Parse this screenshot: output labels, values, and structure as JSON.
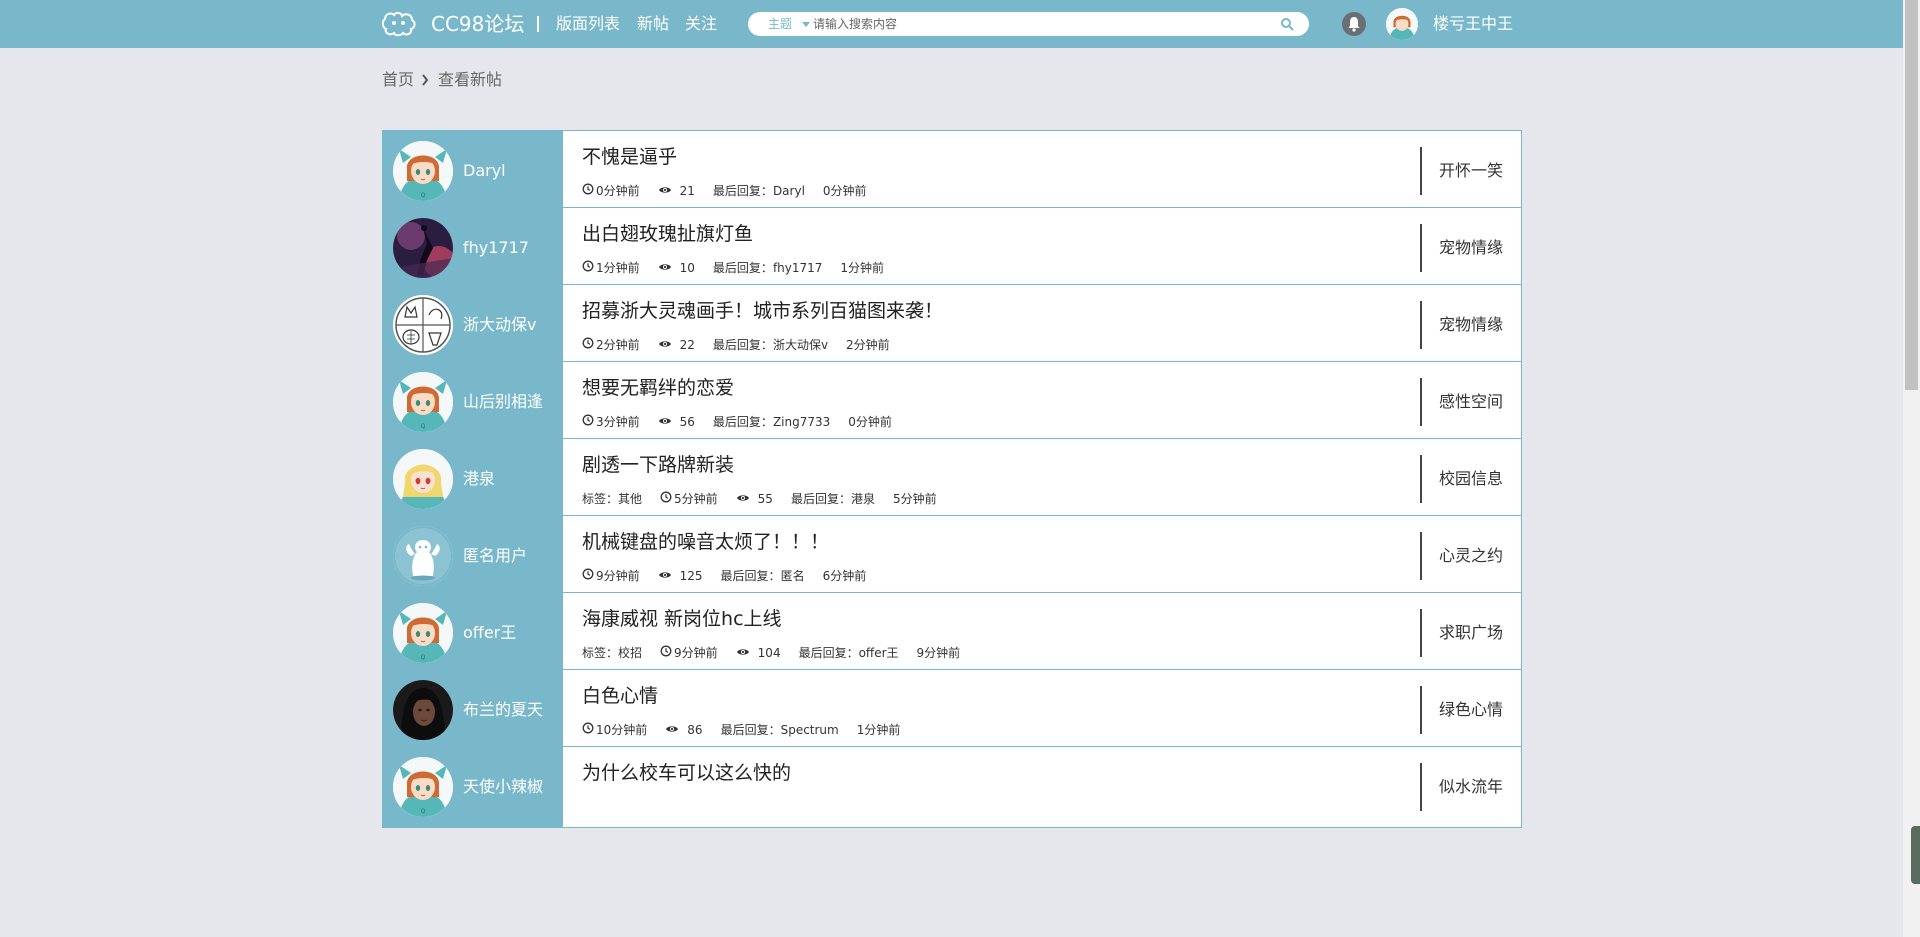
{
  "header": {
    "brand": "CC98论坛",
    "separator": "|",
    "nav": [
      {
        "label": "版面列表"
      },
      {
        "label": "新帖"
      },
      {
        "label": "关注"
      }
    ],
    "search": {
      "scope": "主题",
      "placeholder": "请输入搜索内容",
      "value": ""
    },
    "user": {
      "name": "楼亏王中王"
    }
  },
  "breadcrumb": {
    "home": "首页",
    "current": "查看新帖"
  },
  "labels": {
    "last_reply": "最后回复：",
    "tag": "标签："
  },
  "colors": {
    "accent": "#79b8ca",
    "background": "#e6e7ec"
  },
  "topics": [
    {
      "author": "Daryl",
      "avatar": "anime-girl-teal-hood",
      "title": "不愧是逼乎",
      "tag": "",
      "time": "0分钟前",
      "views": "21",
      "last_reply_user": "Daryl",
      "last_reply_time": "0分钟前",
      "board": "开怀一笑"
    },
    {
      "author": "fhy1717",
      "avatar": "dark-purple-figure",
      "title": "出白翅玫瑰扯旗灯鱼",
      "tag": "",
      "time": "1分钟前",
      "views": "10",
      "last_reply_user": "fhy1717",
      "last_reply_time": "1分钟前",
      "board": "宠物情缘"
    },
    {
      "author": "浙大动保v",
      "avatar": "cat-sketch",
      "title": "招募浙大灵魂画手！城市系列百猫图来袭！",
      "tag": "",
      "time": "2分钟前",
      "views": "22",
      "last_reply_user": "浙大动保v",
      "last_reply_time": "2分钟前",
      "board": "宠物情缘"
    },
    {
      "author": "山后别相逢",
      "avatar": "anime-girl-teal-hood",
      "title": "想要无羁绊的恋爱",
      "tag": "",
      "time": "3分钟前",
      "views": "56",
      "last_reply_user": "Zing7733",
      "last_reply_time": "0分钟前",
      "board": "感性空间"
    },
    {
      "author": "港泉",
      "avatar": "anime-girl-blonde",
      "title": "剧透一下路牌新装",
      "tag": "其他",
      "time": "5分钟前",
      "views": "55",
      "last_reply_user": "港泉",
      "last_reply_time": "5分钟前",
      "board": "校园信息"
    },
    {
      "author": "匿名用户",
      "avatar": "anonymous-mascot",
      "title": "机械键盘的噪音太烦了！！！",
      "tag": "",
      "time": "9分钟前",
      "views": "125",
      "last_reply_user": "匿名",
      "last_reply_time": "6分钟前",
      "board": "心灵之约"
    },
    {
      "author": "offer王",
      "avatar": "anime-girl-teal-hood",
      "title": "海康威视 新岗位hc上线",
      "tag": "校招",
      "time": "9分钟前",
      "views": "104",
      "last_reply_user": "offer王",
      "last_reply_time": "9分钟前",
      "board": "求职广场"
    },
    {
      "author": "布兰的夏天",
      "avatar": "dark-portrait",
      "title": "白色心情",
      "tag": "",
      "time": "10分钟前",
      "views": "86",
      "last_reply_user": "Spectrum",
      "last_reply_time": "1分钟前",
      "board": "绿色心情"
    },
    {
      "author": "天使小辣椒",
      "avatar": "anime-girl-teal-hood",
      "title": "为什么校车可以这么快的",
      "tag": "",
      "time": "",
      "views": "",
      "last_reply_user": "",
      "last_reply_time": "",
      "board": "似水流年"
    }
  ]
}
